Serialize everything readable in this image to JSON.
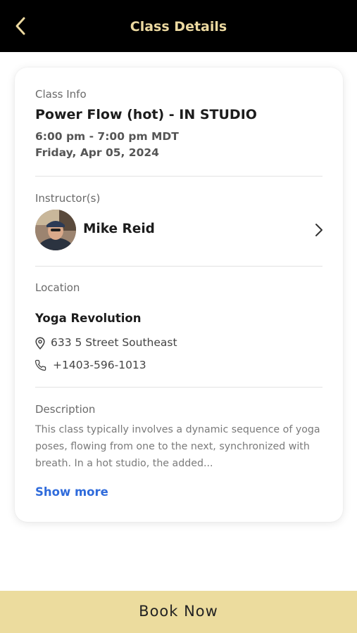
{
  "header": {
    "title": "Class Details",
    "back_icon": "chevron-left-icon"
  },
  "class_info": {
    "label": "Class Info",
    "name": "Power Flow (hot) - IN STUDIO",
    "time": "6:00 pm - 7:00 pm MDT",
    "date": "Friday, Apr 05, 2024"
  },
  "instructors": {
    "label": "Instructor(s)",
    "items": [
      {
        "name": "Mike Reid"
      }
    ]
  },
  "location": {
    "label": "Location",
    "name": "Yoga Revolution",
    "address": "633 5 Street Southeast",
    "phone": "+1403-596-1013"
  },
  "description": {
    "label": "Description",
    "text": "This class typically involves a dynamic sequence of yoga poses, flowing from one to the next, synchronized with breath. In a hot studio, the added...",
    "show_more_label": "Show more"
  },
  "footer": {
    "book_label": "Book Now"
  },
  "colors": {
    "header_bg": "#000000",
    "header_text": "#ecd9a0",
    "accent_link": "#2f6bdb",
    "book_button_bg": "#ecdc9e"
  }
}
